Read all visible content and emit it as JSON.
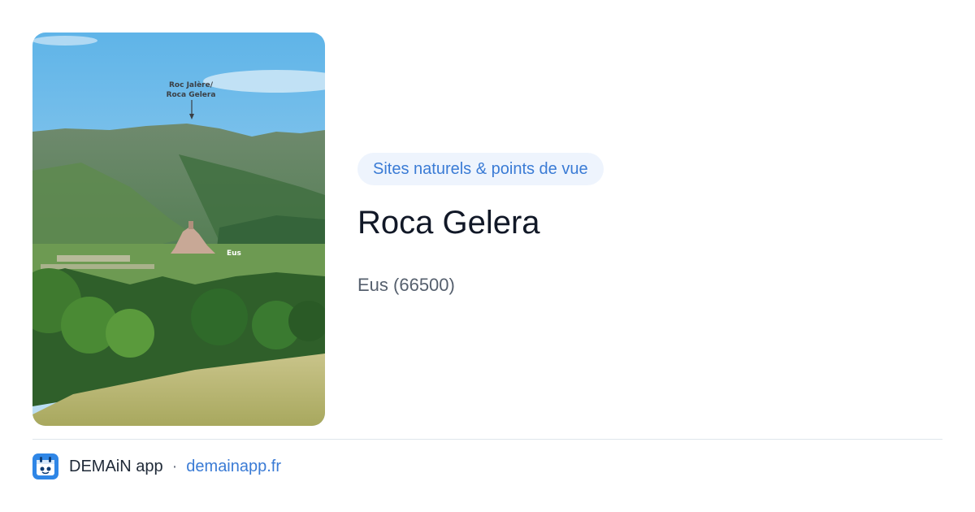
{
  "photo": {
    "alt": "Roca Gelera",
    "annotation_line1": "Roc Jalère/",
    "annotation_line2": "Roca Gelera",
    "village_label": "Eus"
  },
  "category": "Sites naturels & points de vue",
  "title": "Roca Gelera",
  "location": "Eus (66500)",
  "footer": {
    "app_name": "DEMAiN app",
    "separator": "·",
    "site": "demainapp.fr",
    "icon": "demain-app-icon"
  },
  "colors": {
    "accent": "#3a7bd5",
    "category_bg": "#eef4fd",
    "title": "#111827",
    "location": "#56606e",
    "divider": "#dfe6ec"
  }
}
